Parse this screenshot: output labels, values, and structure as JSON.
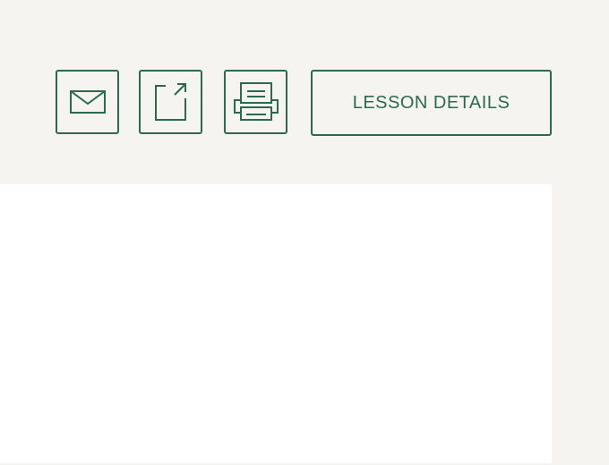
{
  "toolbar": {
    "email_icon": "envelope-icon",
    "share_icon": "external-link-icon",
    "print_icon": "printer-icon",
    "details_label": "LESSON DETAILS"
  },
  "colors": {
    "accent": "#2a6b4b",
    "background": "#f5f4f0",
    "panel": "#ffffff"
  }
}
